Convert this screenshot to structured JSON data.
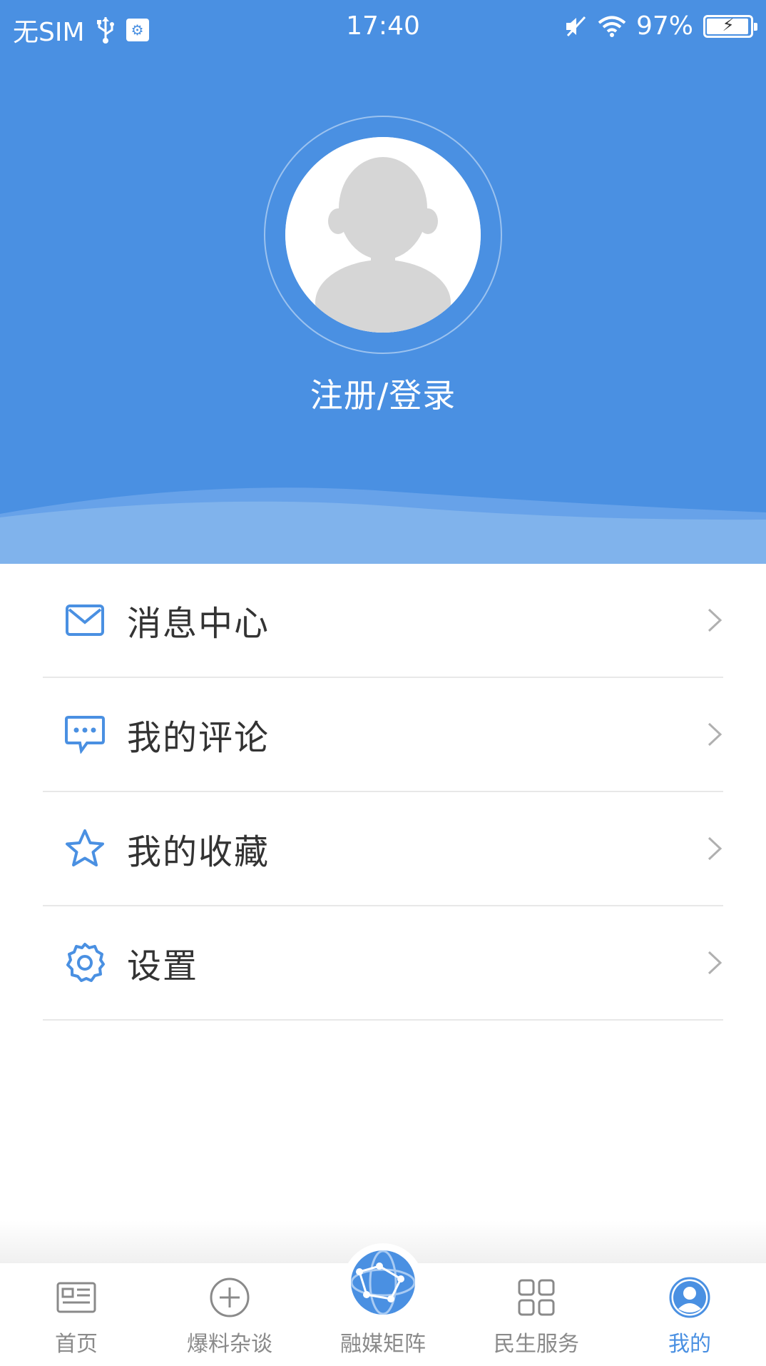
{
  "status_bar": {
    "carrier": "无SIM",
    "time": "17:40",
    "battery_percent": "97%",
    "battery_level": 0.97,
    "icons": [
      "usb-icon",
      "usb-debug-icon",
      "mute-icon",
      "wifi-icon",
      "battery-charging-icon"
    ]
  },
  "header": {
    "login_text": "注册/登录",
    "avatar_icon": "default-avatar-icon"
  },
  "menu": {
    "items": [
      {
        "label": "消息中心",
        "icon": "mail-icon"
      },
      {
        "label": "我的评论",
        "icon": "comment-icon"
      },
      {
        "label": "我的收藏",
        "icon": "star-icon"
      },
      {
        "label": "设置",
        "icon": "gear-icon"
      }
    ]
  },
  "tabbar": {
    "tabs": [
      {
        "label": "首页",
        "icon": "news-icon",
        "active": false
      },
      {
        "label": "爆料杂谈",
        "icon": "plus-circle-icon",
        "active": false
      },
      {
        "label": "融媒矩阵",
        "icon": "globe-network-icon",
        "active": false
      },
      {
        "label": "民生服务",
        "icon": "grid-icon",
        "active": false
      },
      {
        "label": "我的",
        "icon": "user-circle-icon",
        "active": true
      }
    ]
  },
  "colors": {
    "primary": "#4a90e2",
    "text": "#333333",
    "inactive": "#8a8a8a",
    "divider": "#e8e8e8"
  }
}
